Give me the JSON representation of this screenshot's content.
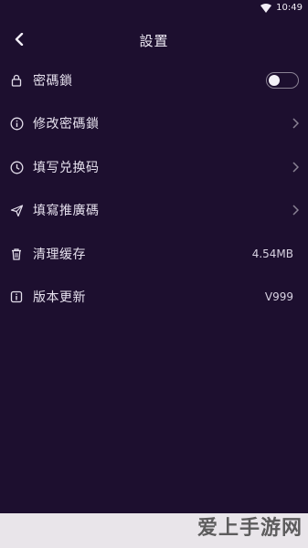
{
  "status_bar": {
    "time": "10:49"
  },
  "header": {
    "title": "設置"
  },
  "settings": [
    {
      "id": "lock",
      "label": "密碼鎖",
      "type": "toggle",
      "toggle_on": false
    },
    {
      "id": "change-lock",
      "label": "修改密碼鎖",
      "type": "chevron"
    },
    {
      "id": "redeem",
      "label": "填写兑换码",
      "type": "chevron"
    },
    {
      "id": "referral",
      "label": "填寫推廣碼",
      "type": "chevron"
    },
    {
      "id": "cache",
      "label": "清理缓存",
      "type": "value",
      "value": "4.54MB"
    },
    {
      "id": "version",
      "label": "版本更新",
      "type": "value",
      "value": "V999"
    }
  ],
  "watermark": {
    "text": "爱上手游网"
  },
  "colors": {
    "background": "#1d0f2f",
    "text": "#e6e1ee",
    "footer": "#e9e5ea"
  },
  "icons": [
    "back-arrow-icon",
    "lock-icon",
    "info-icon",
    "clock-icon",
    "send-icon",
    "trash-icon",
    "info-icon"
  ]
}
